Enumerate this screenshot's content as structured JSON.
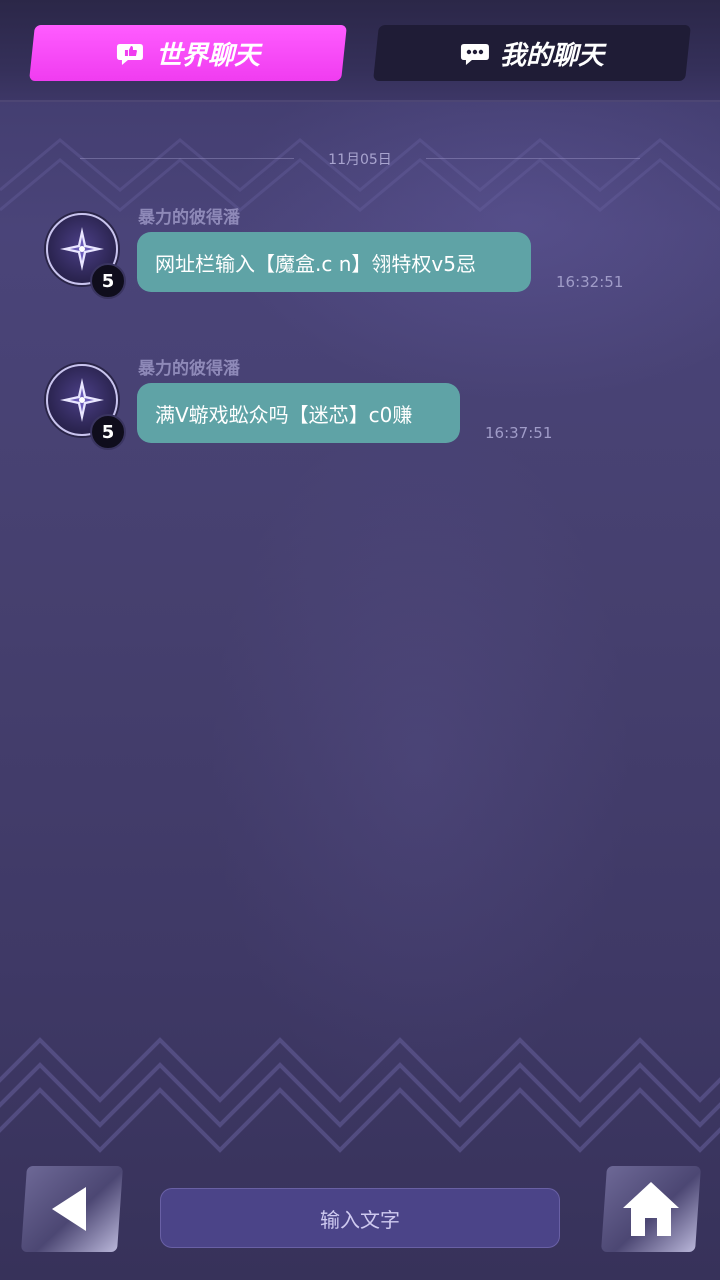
{
  "tabs": [
    {
      "label": "世界聊天",
      "active": true
    },
    {
      "label": "我的聊天",
      "active": false
    }
  ],
  "date_divider": "11月05日",
  "messages": [
    {
      "username": "暴力的彼得潘",
      "level": "5",
      "text": "网址栏输入【魔盒.c n】翎特权v5忌",
      "time": "16:32:51"
    },
    {
      "username": "暴力的彼得潘",
      "level": "5",
      "text": "满V蝣戏蚣众吗【迷芯】c0赚",
      "time": "16:37:51"
    }
  ],
  "input": {
    "placeholder": "输入文字"
  },
  "icons": {
    "back": "back-arrow-icon",
    "home": "home-icon",
    "world_chat": "chat-bubble-thumb-icon",
    "my_chat": "chat-bubble-dots-icon",
    "avatar": "compass-star-icon"
  },
  "colors": {
    "active_tab": "#f03cf0",
    "inactive_tab": "#1f1c36",
    "bubble": "#5fa3a6",
    "background": "#46406f"
  }
}
